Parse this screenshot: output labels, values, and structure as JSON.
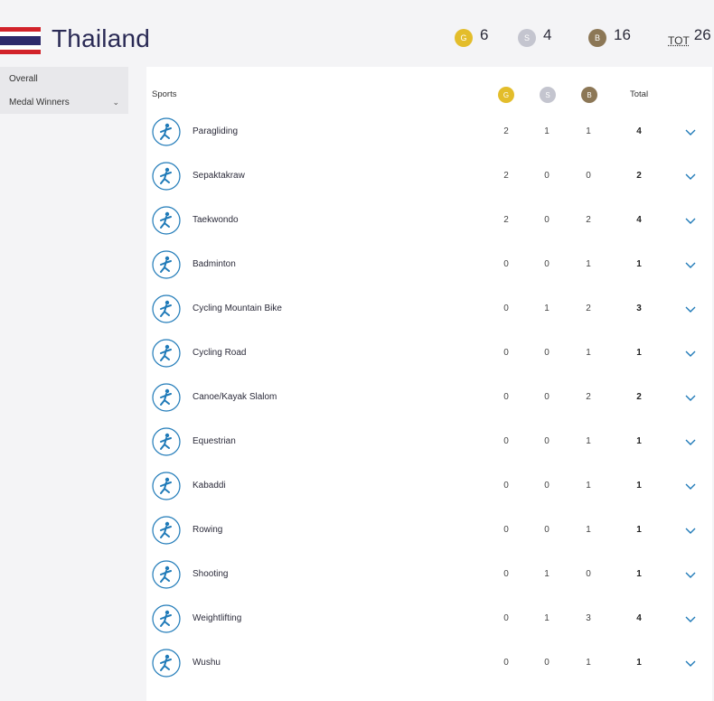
{
  "country": {
    "name": "Thailand",
    "flag_colors": [
      "#d2232a",
      "#ffffff",
      "#2d2a6b",
      "#ffffff",
      "#d2232a"
    ]
  },
  "summary": {
    "gold_badge": "G",
    "gold": "6",
    "silver_badge": "S",
    "silver": "4",
    "bronze_badge": "B",
    "bronze": "16",
    "total_label": "TOT",
    "total": "26"
  },
  "sidebar": {
    "items": [
      {
        "label": "Overall"
      },
      {
        "label": "Medal Winners"
      }
    ]
  },
  "table": {
    "headers": {
      "sports": "Sports",
      "gold": "G",
      "silver": "S",
      "bronze": "B",
      "total": "Total"
    },
    "rows": [
      {
        "sport": "Paragliding",
        "icon": "paragliding-icon",
        "g": "2",
        "s": "1",
        "b": "1",
        "total": "4"
      },
      {
        "sport": "Sepaktakraw",
        "icon": "sepaktakraw-icon",
        "g": "2",
        "s": "0",
        "b": "0",
        "total": "2"
      },
      {
        "sport": "Taekwondo",
        "icon": "taekwondo-icon",
        "g": "2",
        "s": "0",
        "b": "2",
        "total": "4"
      },
      {
        "sport": "Badminton",
        "icon": "badminton-icon",
        "g": "0",
        "s": "0",
        "b": "1",
        "total": "1"
      },
      {
        "sport": "Cycling Mountain Bike",
        "icon": "cycling-mountain-bike-icon",
        "g": "0",
        "s": "1",
        "b": "2",
        "total": "3"
      },
      {
        "sport": "Cycling Road",
        "icon": "cycling-road-icon",
        "g": "0",
        "s": "0",
        "b": "1",
        "total": "1"
      },
      {
        "sport": "Canoe/Kayak Slalom",
        "icon": "canoe-kayak-slalom-icon",
        "g": "0",
        "s": "0",
        "b": "2",
        "total": "2"
      },
      {
        "sport": "Equestrian",
        "icon": "equestrian-icon",
        "g": "0",
        "s": "0",
        "b": "1",
        "total": "1"
      },
      {
        "sport": "Kabaddi",
        "icon": "kabaddi-icon",
        "g": "0",
        "s": "0",
        "b": "1",
        "total": "1"
      },
      {
        "sport": "Rowing",
        "icon": "rowing-icon",
        "g": "0",
        "s": "0",
        "b": "1",
        "total": "1"
      },
      {
        "sport": "Shooting",
        "icon": "shooting-icon",
        "g": "0",
        "s": "1",
        "b": "0",
        "total": "1"
      },
      {
        "sport": "Weightlifting",
        "icon": "weightlifting-icon",
        "g": "0",
        "s": "1",
        "b": "3",
        "total": "4"
      },
      {
        "sport": "Wushu",
        "icon": "wushu-icon",
        "g": "0",
        "s": "0",
        "b": "1",
        "total": "1"
      }
    ]
  },
  "colors": {
    "gold": "#e3bd2b",
    "silver": "#c4c5cf",
    "bronze": "#8c7756",
    "accent": "#1f7ab8",
    "title": "#2a2a55"
  }
}
